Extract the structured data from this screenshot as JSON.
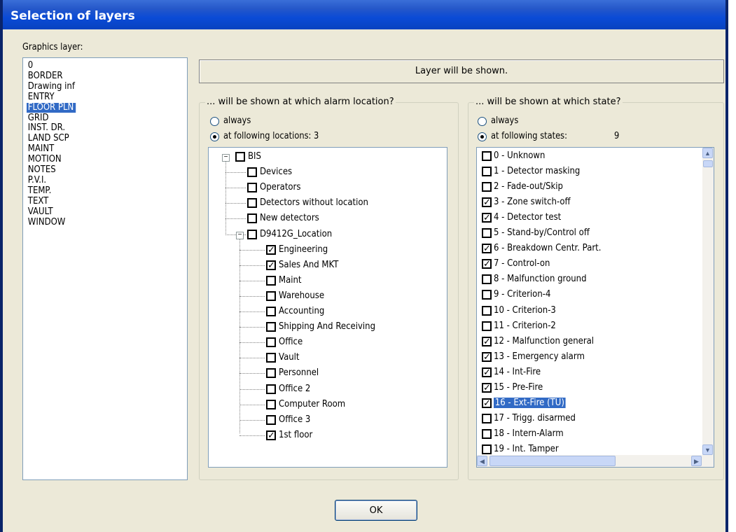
{
  "window": {
    "title": "Selection of layers"
  },
  "graphics_layer": {
    "label": "Graphics layer:",
    "items": [
      "0",
      "BORDER",
      "Drawing inf",
      "ENTRY",
      "FLOOR PLN",
      "GRID",
      "INST. DR.",
      "LAND SCP",
      "MAINT",
      "MOTION",
      "NOTES",
      "P.V.I.",
      "TEMP.",
      "TEXT",
      "VAULT",
      "WINDOW"
    ],
    "selected": "FLOOR PLN"
  },
  "status": {
    "text": "Layer will be shown."
  },
  "locations": {
    "legend": "... will be shown at which alarm location?",
    "always_label": "always",
    "following_label": "at following locations: 3",
    "selected_option": "following",
    "tree": [
      {
        "label": "BIS",
        "checked": false
      },
      {
        "label": "Devices",
        "checked": false
      },
      {
        "label": "Operators",
        "checked": false
      },
      {
        "label": "Detectors without location",
        "checked": false
      },
      {
        "label": "New detectors",
        "checked": false
      },
      {
        "label": "D9412G_Location",
        "checked": false
      },
      {
        "label": "Engineering",
        "checked": true
      },
      {
        "label": "Sales And MKT",
        "checked": true
      },
      {
        "label": "Maint",
        "checked": false
      },
      {
        "label": "Warehouse",
        "checked": false
      },
      {
        "label": "Accounting",
        "checked": false
      },
      {
        "label": "Shipping And Receiving",
        "checked": false
      },
      {
        "label": "Office",
        "checked": false
      },
      {
        "label": "Vault",
        "checked": false
      },
      {
        "label": "Personnel",
        "checked": false
      },
      {
        "label": "Office 2",
        "checked": false
      },
      {
        "label": "Computer Room",
        "checked": false
      },
      {
        "label": "Office 3",
        "checked": false
      },
      {
        "label": "1st floor",
        "checked": true
      }
    ]
  },
  "states": {
    "legend": "... will be shown at which state?",
    "always_label": "always",
    "following_label": "at following states:",
    "count": "9",
    "selected_option": "following",
    "items": [
      {
        "label": "0 - Unknown",
        "checked": false
      },
      {
        "label": "1 - Detector  masking",
        "checked": false
      },
      {
        "label": "2 - Fade-out/Skip",
        "checked": false
      },
      {
        "label": "3 - Zone switch-off",
        "checked": true
      },
      {
        "label": "4 - Detector test",
        "checked": true
      },
      {
        "label": "5 - Stand-by/Control off",
        "checked": false
      },
      {
        "label": "6 - Breakdown Centr. Part.",
        "checked": true
      },
      {
        "label": "7 - Control-on",
        "checked": true
      },
      {
        "label": "8 - Malfunction ground",
        "checked": false
      },
      {
        "label": "9 - Criterion-4",
        "checked": false
      },
      {
        "label": "10 - Criterion-3",
        "checked": false
      },
      {
        "label": "11 - Criterion-2",
        "checked": false
      },
      {
        "label": "12 - Malfunction general",
        "checked": true
      },
      {
        "label": "13 - Emergency alarm",
        "checked": true
      },
      {
        "label": "14 - Int-Fire",
        "checked": true
      },
      {
        "label": "15 - Pre-Fire",
        "checked": true
      },
      {
        "label": "16 - Ext-Fire (TU)",
        "checked": true,
        "selected": true
      },
      {
        "label": "17 - Trigg. disarmed",
        "checked": false
      },
      {
        "label": "18 - Intern-Alarm",
        "checked": false
      },
      {
        "label": "19 - Int. Tamper",
        "checked": false
      }
    ]
  },
  "ok_button": {
    "label": "OK"
  }
}
